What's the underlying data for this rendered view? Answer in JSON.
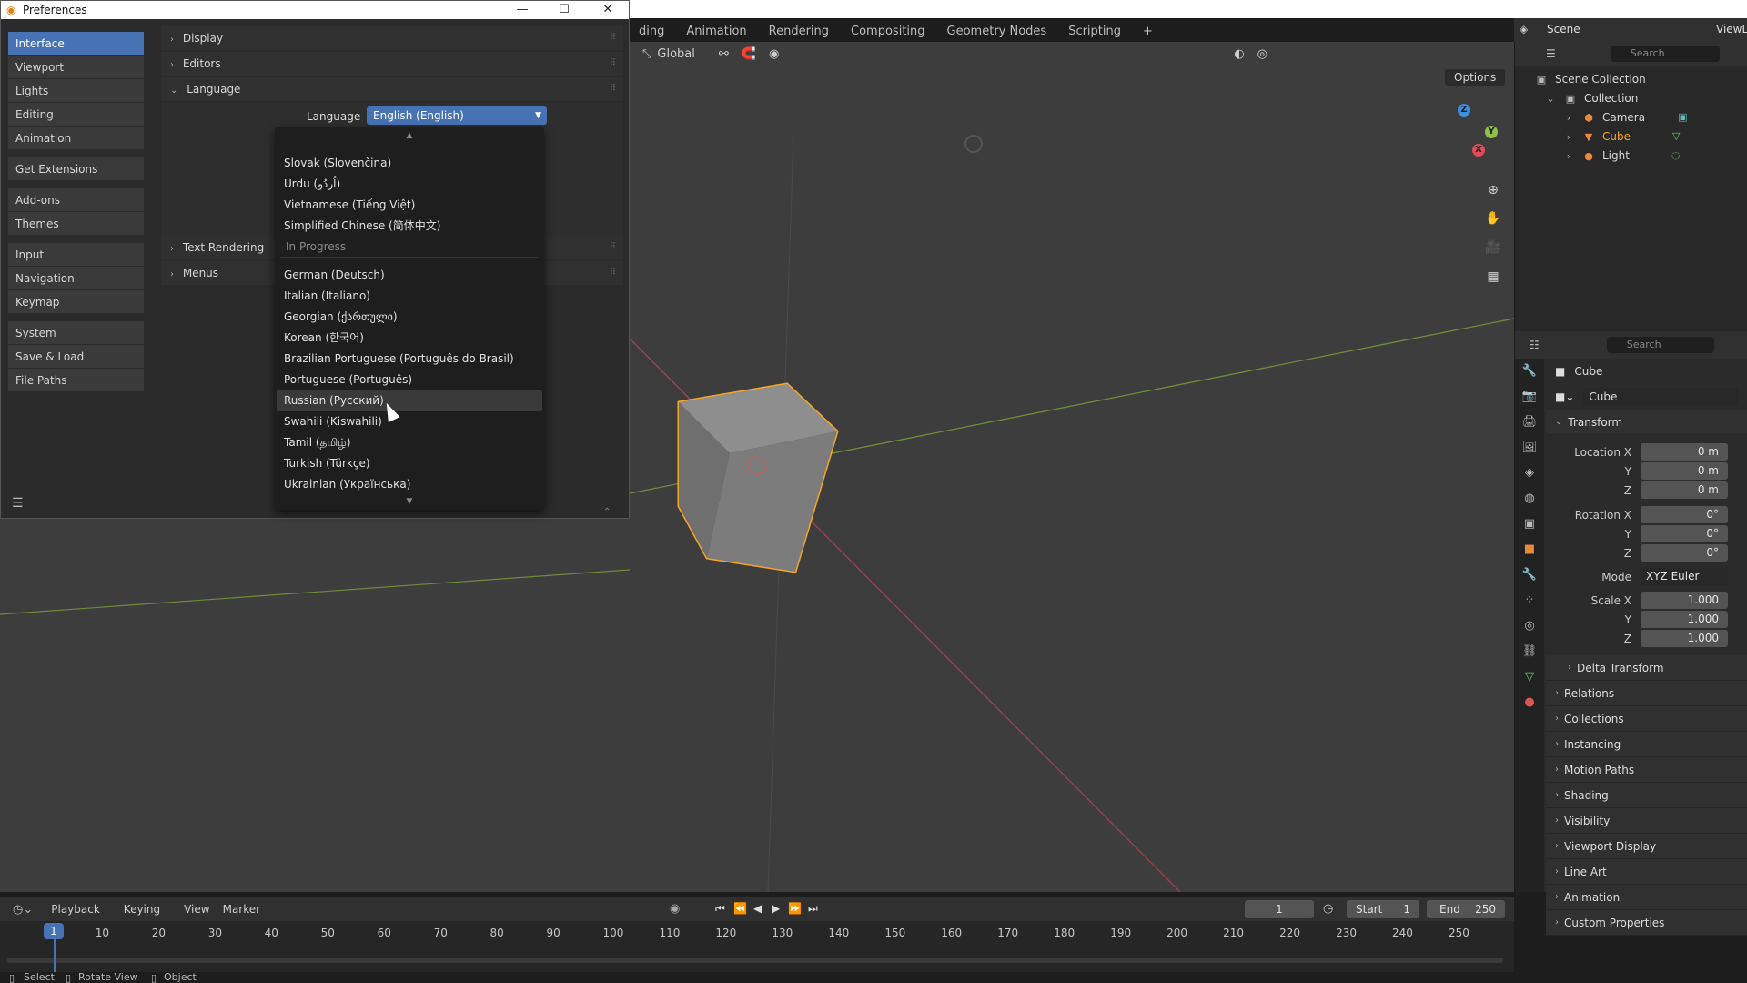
{
  "workspaces": [
    "ding",
    "Animation",
    "Rendering",
    "Compositing",
    "Geometry Nodes",
    "Scripting",
    "+"
  ],
  "scene": {
    "label": "Scene",
    "view_layer": "ViewL"
  },
  "viewport": {
    "orientation": "Global",
    "options_label": "Options"
  },
  "gizmo": {
    "x": "X",
    "y": "Y",
    "z": "Z"
  },
  "outliner": {
    "search_placeholder": "Search",
    "items": [
      "Scene Collection",
      "Collection",
      "Camera",
      "Cube",
      "Light"
    ]
  },
  "properties": {
    "search_placeholder": "Search",
    "object_name": "Cube",
    "data_name": "Cube",
    "transform": {
      "title": "Transform",
      "location_label": "Location X",
      "loc_x": "0 m",
      "loc_y": "0 m",
      "loc_z": "0 m",
      "rotation_label": "Rotation X",
      "rot_x": "0°",
      "rot_y": "0°",
      "rot_z": "0°",
      "mode_label": "Mode",
      "mode_value": "XYZ Euler",
      "scale_label": "Scale X",
      "scale_x": "1.000",
      "scale_y": "1.000",
      "scale_z": "1.000",
      "y": "Y",
      "z": "Z"
    },
    "delta": "Delta Transform",
    "panels": [
      "Relations",
      "Collections",
      "Instancing",
      "Motion Paths",
      "Shading",
      "Visibility",
      "Viewport Display",
      "Line Art",
      "Animation",
      "Custom Properties"
    ]
  },
  "timeline": {
    "menus": [
      "Playback",
      "Keying",
      "View",
      "Marker"
    ],
    "current_frame": "1",
    "start_label": "Start",
    "start_value": "1",
    "end_label": "End",
    "end_value": "250",
    "ticks": [
      "1",
      "10",
      "20",
      "30",
      "40",
      "50",
      "60",
      "70",
      "80",
      "90",
      "100",
      "110",
      "120",
      "130",
      "140",
      "150",
      "160",
      "170",
      "180",
      "190",
      "200",
      "210",
      "220",
      "230",
      "240",
      "250"
    ]
  },
  "status": {
    "select": "Select",
    "rotate": "Rotate View",
    "object": "Object"
  },
  "prefs": {
    "title": "Preferences",
    "nav": {
      "interface": "Interface",
      "viewport": "Viewport",
      "lights": "Lights",
      "editing": "Editing",
      "animation": "Animation",
      "extensions": "Get Extensions",
      "addons": "Add-ons",
      "themes": "Themes",
      "input": "Input",
      "navigation": "Navigation",
      "keymap": "Keymap",
      "system": "System",
      "save_load": "Save & Load",
      "file_paths": "File Paths"
    },
    "sections": {
      "display": "Display",
      "editors": "Editors",
      "language": "Language",
      "text_rendering": "Text Rendering",
      "menus": "Menus"
    },
    "language_label": "Language",
    "language_value": "English (English)"
  },
  "dropdown": {
    "complete": [
      "Slovak (Slovenčina)",
      "Urdu (اُردُو)",
      "Vietnamese (Tiếng Việt)",
      "Simplified Chinese (简体中文)"
    ],
    "heading": "In Progress",
    "in_progress": [
      "German (Deutsch)",
      "Italian (Italiano)",
      "Georgian (ქართული)",
      "Korean (한국어)",
      "Brazilian Portuguese (Português do Brasil)",
      "Portuguese (Português)",
      "Russian (Русский)",
      "Swahili (Kiswahili)",
      "Tamil (தமிழ்)",
      "Turkish (Türkçe)",
      "Ukrainian (Українська)"
    ],
    "highlighted": "Russian (Русский)"
  },
  "colors": {
    "accent": "#4772b3",
    "selected_outline": "#f5a623"
  }
}
